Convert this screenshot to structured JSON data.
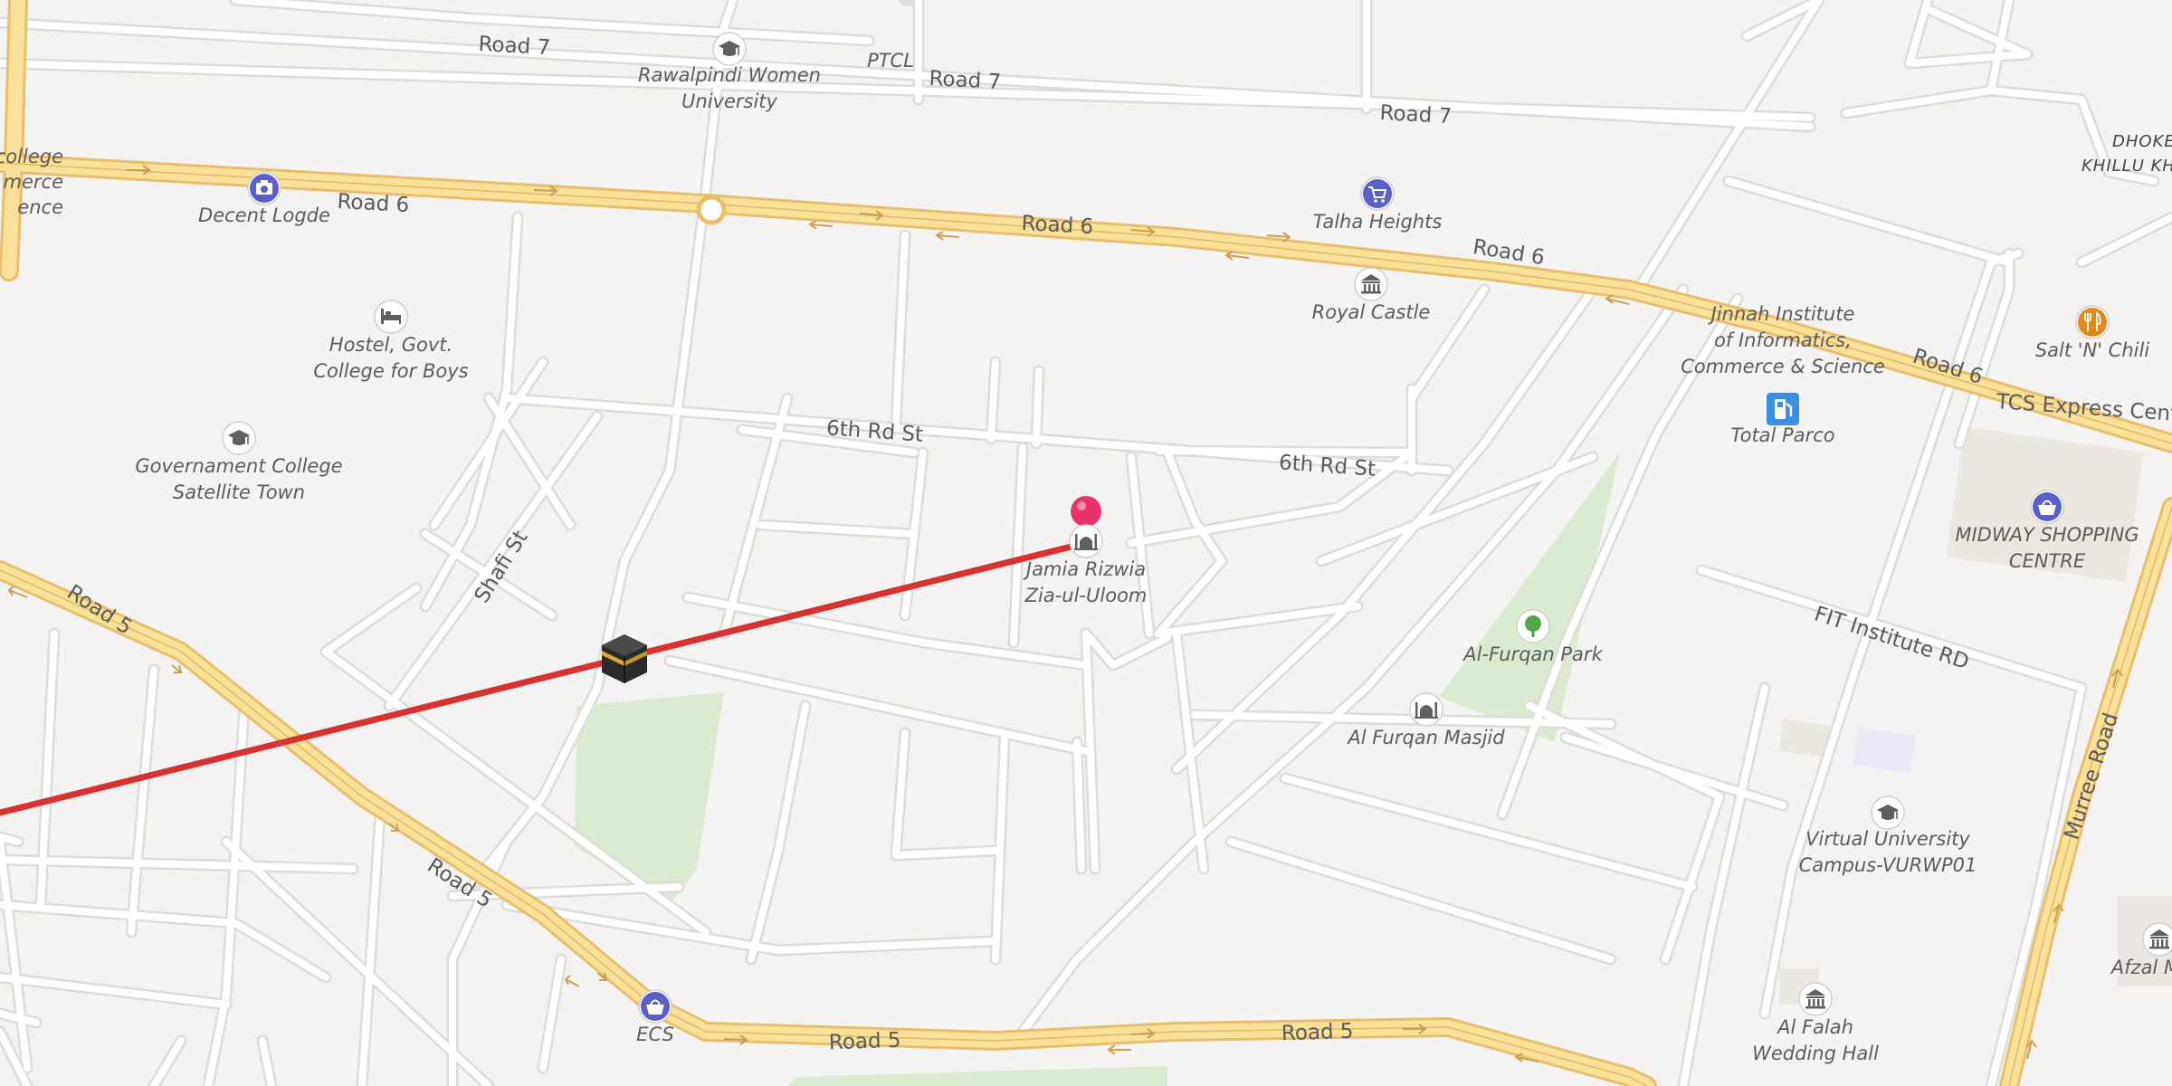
{
  "map": {
    "road_labels": [
      {
        "id": "road-7-a",
        "text": "Road 7"
      },
      {
        "id": "road-7-b",
        "text": "Road 7"
      },
      {
        "id": "road-7-c",
        "text": "Road 7"
      },
      {
        "id": "road-6-a",
        "text": "Road 6"
      },
      {
        "id": "road-6-b",
        "text": "Road 6"
      },
      {
        "id": "road-6-c",
        "text": "Road 6"
      },
      {
        "id": "road-6-d",
        "text": "Road 6"
      },
      {
        "id": "road-5-a",
        "text": "Road 5"
      },
      {
        "id": "road-5-b",
        "text": "Road 5"
      },
      {
        "id": "road-5-c",
        "text": "Road 5"
      },
      {
        "id": "road-5-d",
        "text": "Road 5"
      },
      {
        "id": "6th-rd-st-a",
        "text": "6th Rd St"
      },
      {
        "id": "6th-rd-st-b",
        "text": "6th Rd St"
      },
      {
        "id": "shafi-st",
        "text": "Shafi St"
      },
      {
        "id": "fit-institute-rd",
        "text": "FIT Institute RD"
      },
      {
        "id": "murree-road",
        "text": "Murree Road"
      },
      {
        "id": "ptcl",
        "text": "PTCL"
      },
      {
        "id": "tcs-express",
        "text": "TCS Express Cent"
      }
    ],
    "pois": [
      {
        "id": "rawalpindi-women-university",
        "lines": [
          "Rawalpindi Women",
          "University"
        ],
        "icon": "graduation-cap-icon"
      },
      {
        "id": "decent-logde",
        "lines": [
          "Decent Logde"
        ],
        "icon": "camera-icon"
      },
      {
        "id": "hostel-govt-college",
        "lines": [
          "Hostel, Govt.",
          "College for Boys"
        ],
        "icon": "bed-icon"
      },
      {
        "id": "governament-college",
        "lines": [
          "Governament College",
          "Satellite Town"
        ],
        "icon": "graduation-cap-icon"
      },
      {
        "id": "talha-heights",
        "lines": [
          "Talha Heights"
        ],
        "icon": "shopping-cart-icon"
      },
      {
        "id": "royal-castle",
        "lines": [
          "Royal Castle"
        ],
        "icon": "landmark-icon"
      },
      {
        "id": "jinnah-institute",
        "lines": [
          "Jinnah Institute",
          "of Informatics,",
          "Commerce & Science"
        ],
        "icon": "none"
      },
      {
        "id": "salt-n-chili",
        "lines": [
          "Salt 'N' Chili"
        ],
        "icon": "restaurant-icon"
      },
      {
        "id": "total-parco",
        "lines": [
          "Total Parco"
        ],
        "icon": "fuel-icon"
      },
      {
        "id": "midway-shopping",
        "lines": [
          "MIDWAY SHOPPING",
          "CENTRE"
        ],
        "icon": "shopping-basket-icon"
      },
      {
        "id": "jamia-rizwia",
        "lines": [
          "Jamia Rizwia",
          "Zia-ul-Uloom"
        ],
        "icon": "mosque-icon"
      },
      {
        "id": "al-furqan-park",
        "lines": [
          "Al-Furqan Park"
        ],
        "icon": "tree-icon"
      },
      {
        "id": "al-furqan-masjid",
        "lines": [
          "Al Furqan Masjid"
        ],
        "icon": "mosque-icon"
      },
      {
        "id": "virtual-university",
        "lines": [
          "Virtual University",
          "Campus-VURWP01"
        ],
        "icon": "graduation-cap-icon"
      },
      {
        "id": "ecs",
        "lines": [
          "ECS"
        ],
        "icon": "shopping-basket-icon"
      },
      {
        "id": "al-falah-wedding-hall",
        "lines": [
          "Al Falah",
          "Wedding Hall"
        ],
        "icon": "landmark-icon"
      },
      {
        "id": "afzal-marr",
        "lines": [
          "Afzal Marr"
        ],
        "icon": "landmark-icon"
      }
    ],
    "edge_labels": {
      "top_left_college": [
        "college",
        "merce",
        "ence"
      ],
      "dhoke_khillu": [
        "DHOKE",
        "KHILLU KH"
      ]
    },
    "markers": {
      "pin": {
        "name": "location-pin",
        "color": "#e8336b"
      },
      "kaaba": {
        "name": "kaaba-icon"
      },
      "qibla_line": {
        "color": "#d83131"
      }
    },
    "colors": {
      "background": "#f5f3f1",
      "minor_road": "#ffffff",
      "minor_road_casing": "#dedcd9",
      "major_road_fill": "#fbe09a",
      "major_road_casing": "#e7bf6c",
      "park": "#d9ead0",
      "poi_icon": "#6b6b6b",
      "shop_icon": "#5b5fc7",
      "fuel_icon": "#3b8fe0",
      "food_icon": "#e08a1e",
      "park_icon": "#52a64a"
    }
  }
}
